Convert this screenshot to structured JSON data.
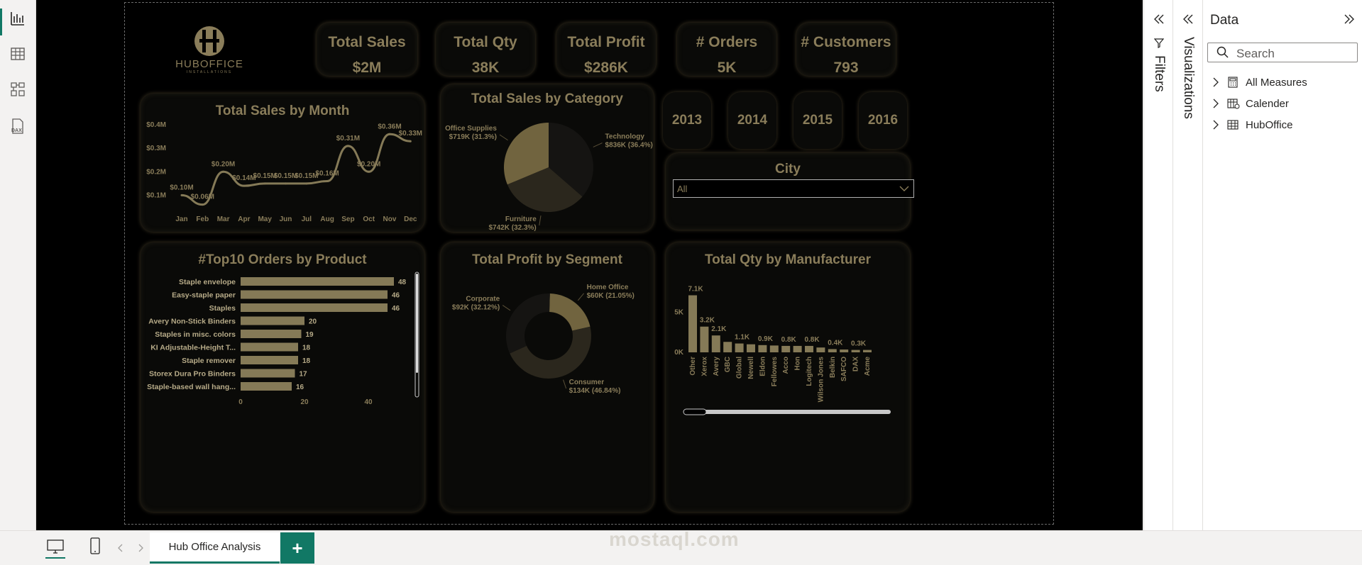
{
  "app": {
    "page_tab": "Hub Office Analysis",
    "add_tab": "+"
  },
  "logo": {
    "name": "HUBOFFICE",
    "tagline": "INSTALLATIONS"
  },
  "kpis": [
    {
      "title": "Total Sales",
      "value": "$2M"
    },
    {
      "title": "Total Qty",
      "value": "38K"
    },
    {
      "title": "Total Profit",
      "value": "$286K"
    },
    {
      "title": "# Orders",
      "value": "5K"
    },
    {
      "title": "# Customers",
      "value": "793"
    }
  ],
  "years": [
    "2013",
    "2014",
    "2015",
    "2016"
  ],
  "city": {
    "title": "City",
    "selected": "All"
  },
  "titles": {
    "sales_by_month": "Total Sales by Month",
    "sales_by_category": "Total Sales by Category",
    "top10_orders": "#Top10 Orders by Product",
    "profit_by_segment": "Total Profit by Segment",
    "qty_by_manufacturer": "Total Qty by Manufacturer"
  },
  "panes": {
    "filters": "Filters",
    "visualizations": "Visualizations",
    "data_title": "Data",
    "search_placeholder": "Search",
    "data_items": [
      "All Measures",
      "Calender",
      "HubOffice"
    ]
  },
  "watermark": "mostaql.com",
  "colors": {
    "accent": "#8a7d5a",
    "bar": "#857a57",
    "background": "#000000",
    "brand_green": "#117865"
  },
  "chart_data": [
    {
      "type": "line",
      "title": "Total Sales by Month",
      "categories": [
        "Jan",
        "Feb",
        "Mar",
        "Apr",
        "May",
        "Jun",
        "Jul",
        "Aug",
        "Sep",
        "Oct",
        "Nov",
        "Dec"
      ],
      "values": [
        0.1,
        0.06,
        0.2,
        0.14,
        0.15,
        0.15,
        0.15,
        0.16,
        0.31,
        0.2,
        0.36,
        0.33
      ],
      "data_labels": [
        "$0.10M",
        "$0.06M",
        "$0.20M",
        "$0.14M",
        "$0.15M",
        "$0.15M",
        "$0.15M",
        "$0.16M",
        "$0.31M",
        "$0.20M",
        "$0.36M",
        "$0.33M"
      ],
      "y_ticks": [
        "$0.1M",
        "$0.2M",
        "$0.3M",
        "$0.4M"
      ],
      "y_tick_values": [
        0.1,
        0.2,
        0.3,
        0.4
      ],
      "ylim": [
        0.05,
        0.4
      ]
    },
    {
      "type": "pie",
      "title": "Total Sales by Category",
      "slices": [
        {
          "name": "Technology",
          "value": 836,
          "label": "$836K (36.4%)",
          "color": "#151412"
        },
        {
          "name": "Furniture",
          "value": 742,
          "label": "$742K (32.3%)",
          "color": "#2b271d"
        },
        {
          "name": "Office Supplies",
          "value": 719,
          "label": "$719K (31.3%)",
          "color": "#71643f"
        }
      ]
    },
    {
      "type": "bar",
      "orientation": "horizontal",
      "title": "#Top10 Orders by Product",
      "categories": [
        "Staple envelope",
        "Easy-staple paper",
        "Staples",
        "Avery Non-Stick Binders",
        "Staples in misc. colors",
        "KI Adjustable-Height T...",
        "Staple remover",
        "Storex Dura Pro Binders",
        "Staple-based wall hang..."
      ],
      "values": [
        48,
        46,
        46,
        20,
        19,
        18,
        18,
        17,
        16
      ],
      "x_ticks": [
        "0",
        "20",
        "40"
      ],
      "x_tick_values": [
        0,
        20,
        40
      ],
      "xlim": [
        0,
        48
      ]
    },
    {
      "type": "pie",
      "variant": "donut",
      "title": "Total Profit by Segment",
      "slices": [
        {
          "name": "Home Office",
          "value": 60,
          "label": "$60K (21.05%)",
          "color": "#71643f"
        },
        {
          "name": "Consumer",
          "value": 134,
          "label": "$134K (46.84%)",
          "color": "#2b271d"
        },
        {
          "name": "Corporate",
          "value": 92,
          "label": "$92K (32.12%)",
          "color": "#151412"
        }
      ]
    },
    {
      "type": "bar",
      "title": "Total Qty by Manufacturer",
      "categories": [
        "Other",
        "Xerox",
        "Avery",
        "GBC",
        "Global",
        "Newell",
        "Eldon",
        "Fellowes",
        "Acco",
        "Hon",
        "Logitech",
        "Wilson Jones",
        "Belkin",
        "SAFCO",
        "DAX",
        "Acme"
      ],
      "values": [
        7.1,
        3.2,
        2.1,
        1.3,
        1.1,
        1.0,
        0.9,
        0.85,
        0.8,
        0.8,
        0.8,
        0.6,
        0.4,
        0.35,
        0.3,
        0.3
      ],
      "data_labels": {
        "0": "7.1K",
        "1": "3.2K",
        "2": "2.1K",
        "4": "1.1K",
        "6": "0.9K",
        "8": "0.8K",
        "10": "0.8K",
        "12": "0.4K",
        "14": "0.3K"
      },
      "y_ticks": [
        "0K",
        "5K"
      ],
      "y_tick_values": [
        0,
        5
      ],
      "ylim": [
        0,
        7.5
      ]
    }
  ]
}
